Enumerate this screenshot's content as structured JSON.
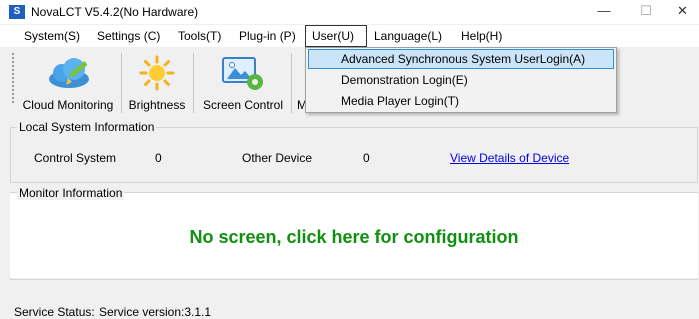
{
  "window": {
    "title": "NovaLCT V5.4.2(No Hardware)",
    "app_icon_glyph": "S",
    "minimize_glyph": "—",
    "maximize_glyph": "☐",
    "close_glyph": "✕"
  },
  "menu": {
    "items": [
      "System(S)",
      "Settings (C)",
      "Tools(T)",
      "Plug-in (P)",
      "User(U)",
      "Language(L)",
      "Help(H)"
    ],
    "active_item": "User(U)"
  },
  "user_menu": {
    "items": [
      "Advanced Synchronous System UserLogin(A)",
      "Demonstration Login(E)",
      "Media Player Login(T)"
    ],
    "highlighted_item": "Advanced Synchronous System UserLogin(A)"
  },
  "toolbar": {
    "buttons": [
      {
        "label": "Cloud Monitoring",
        "icon": "cloud-pen-icon"
      },
      {
        "label": "Brightness",
        "icon": "sun-icon"
      },
      {
        "label": "Screen Control",
        "icon": "screen-gear-icon"
      },
      {
        "label": "M",
        "icon": "truncated-icon"
      }
    ]
  },
  "local_system": {
    "title": "Local System Information",
    "control_system_label": "Control System",
    "control_system_value": "0",
    "other_device_label": "Other Device",
    "other_device_value": "0",
    "view_details_link": "View Details of Device"
  },
  "monitor": {
    "title": "Monitor Information",
    "config_prompt": "No screen, click here for configuration"
  },
  "status": {
    "service_status_label": "Service Status:",
    "service_version": "Service version:3.1.1"
  },
  "colors": {
    "accent_green": "#109010",
    "link_blue": "#0000ee",
    "highlight_bg": "#cce4f7",
    "highlight_border": "#2a8fd8"
  }
}
